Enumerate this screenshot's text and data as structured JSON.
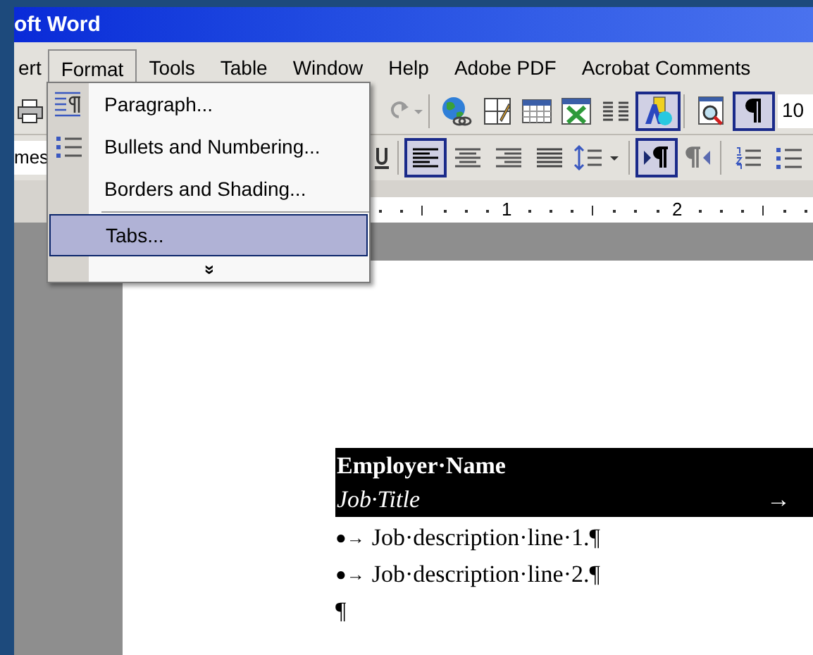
{
  "window": {
    "title": "oft Word"
  },
  "menu_bar": [
    {
      "label": "ert",
      "selected": false
    },
    {
      "label": "Format",
      "selected": true
    },
    {
      "label": "Tools",
      "selected": false
    },
    {
      "label": "Table",
      "selected": false
    },
    {
      "label": "Window",
      "selected": false
    },
    {
      "label": "Help",
      "selected": false
    },
    {
      "label": "Adobe PDF",
      "selected": false
    },
    {
      "label": "Acrobat Comments",
      "selected": false
    }
  ],
  "format_menu": {
    "items": [
      {
        "label": "Paragraph...",
        "kind": "paragraph",
        "selected": false
      },
      {
        "label": "Bullets and Numbering...",
        "kind": "bullets",
        "selected": false
      },
      {
        "label": "Borders and Shading...",
        "selected": false
      },
      {
        "label": "Tabs...",
        "selected": true
      }
    ],
    "more": "»"
  },
  "standard_toolbar": {
    "buttons": [
      {
        "kind": "print",
        "pressed": false
      },
      {
        "kind": "redo",
        "pressed": false
      },
      {
        "kind": "web",
        "pressed": false
      },
      {
        "kind": "draw-table",
        "pressed": false
      },
      {
        "kind": "table",
        "pressed": false
      },
      {
        "kind": "sheet",
        "pressed": false
      },
      {
        "kind": "columns",
        "pressed": false
      },
      {
        "kind": "drawing",
        "pressed": true
      },
      {
        "kind": "map",
        "pressed": false
      },
      {
        "kind": "pilcrow",
        "pressed": true
      }
    ],
    "zoom": "10"
  },
  "formatting_toolbar": {
    "font": "mes",
    "buttons": [
      {
        "kind": "underline",
        "pressed": false
      },
      {
        "kind": "align-left",
        "pressed": true
      },
      {
        "kind": "align-center",
        "pressed": false
      },
      {
        "kind": "align-right",
        "pressed": false
      },
      {
        "kind": "justify",
        "pressed": false
      },
      {
        "kind": "line-spacing",
        "pressed": false
      },
      {
        "kind": "ltr",
        "pressed": true
      },
      {
        "kind": "rtl",
        "pressed": false
      },
      {
        "kind": "numbering",
        "pressed": false
      },
      {
        "kind": "bullets",
        "pressed": false
      }
    ]
  },
  "ruler": {
    "labels": [
      "1",
      "2"
    ]
  },
  "document": {
    "header": {
      "employer": "Employer·Name",
      "job_title": "Job·Title",
      "tab_mark": "→"
    },
    "bullets": [
      {
        "marker": "●→",
        "text": "Job·description·line·1.¶"
      },
      {
        "marker": "●→",
        "text": "Job·description·line·2.¶"
      }
    ],
    "end_mark": "¶"
  }
}
